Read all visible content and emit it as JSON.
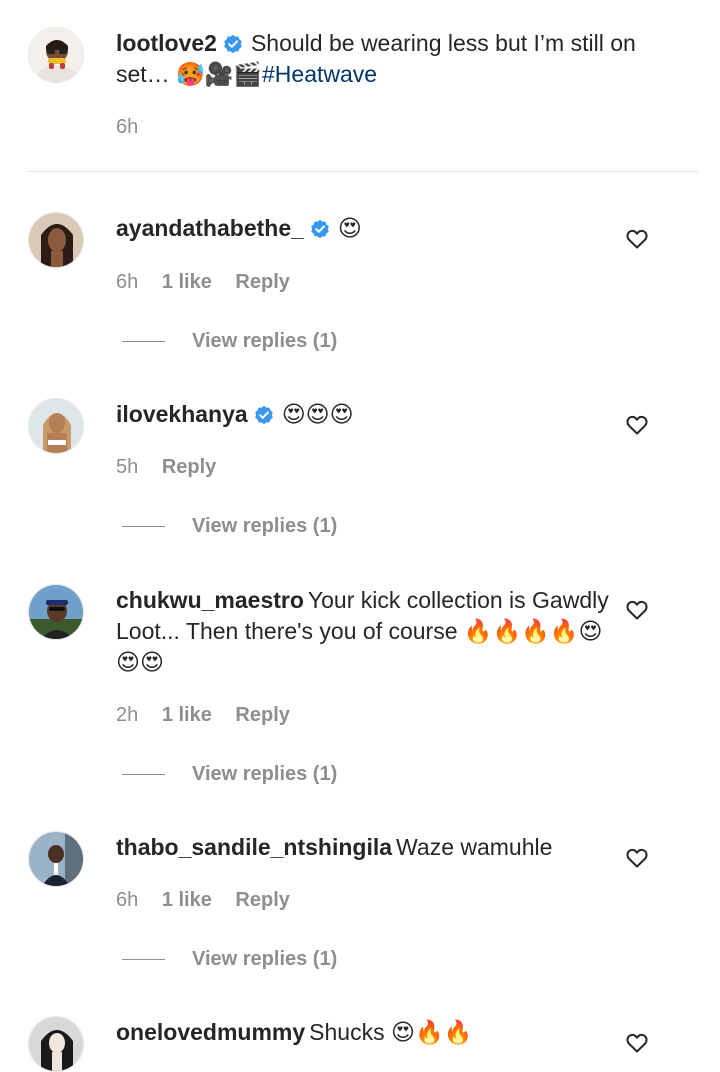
{
  "caption": {
    "username": "lootlove2",
    "verified": true,
    "text": "Should be wearing less but I’m still on set… 🥵🎥🎬",
    "hashtag": "#Heatwave",
    "time": "6h"
  },
  "comments": [
    {
      "username": "ayandathabethe_",
      "verified": true,
      "text": "😍",
      "time": "6h",
      "likes": "1 like",
      "reply_label": "Reply",
      "view_replies": "View replies (1)"
    },
    {
      "username": "ilovekhanya",
      "verified": true,
      "text": "😍😍😍",
      "time": "5h",
      "likes": "",
      "reply_label": "Reply",
      "view_replies": "View replies (1)"
    },
    {
      "username": "chukwu_maestro",
      "verified": false,
      "text": "Your kick collection is Gawdly Loot... Then there's you of course 🔥🔥🔥🔥😍😍😍",
      "time": "2h",
      "likes": "1 like",
      "reply_label": "Reply",
      "view_replies": "View replies (1)"
    },
    {
      "username": "thabo_sandile_ntshingila",
      "verified": false,
      "text": "Waze wamuhle",
      "time": "6h",
      "likes": "1 like",
      "reply_label": "Reply",
      "view_replies": "View replies (1)"
    },
    {
      "username": "onelovedmummy",
      "verified": false,
      "text": "Shucks 😍🔥🔥"
    }
  ],
  "icons": {
    "verified_badge": "verified-badge-icon",
    "like": "heart-outline-icon"
  },
  "colors": {
    "verified": "#3897f0",
    "hashtag": "#00376b",
    "secondary_text": "#8e8e8e"
  }
}
